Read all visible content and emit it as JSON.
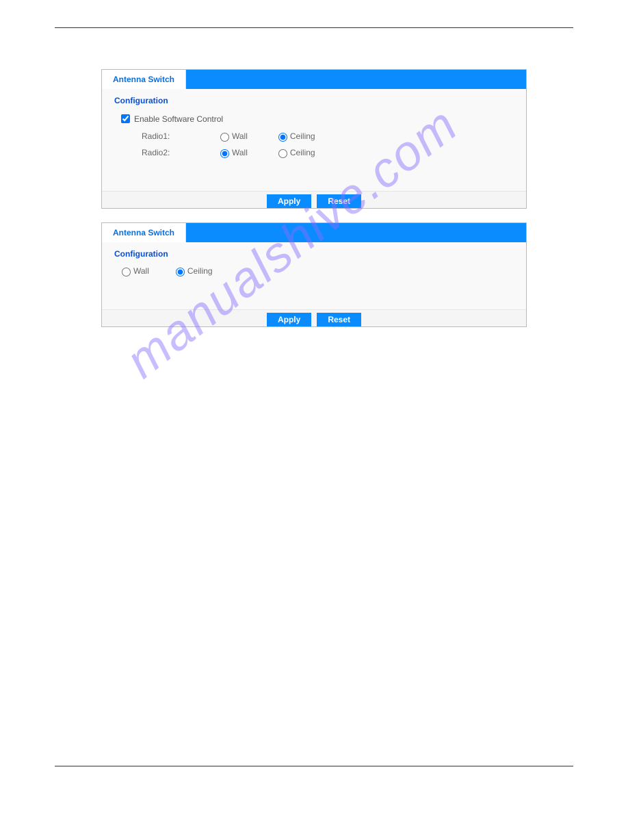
{
  "watermark": "manualshive.com",
  "panel1": {
    "tab": "Antenna Switch",
    "section": "Configuration",
    "enable_label": "Enable Software Control",
    "enable_checked": true,
    "rows": [
      {
        "label": "Radio1:",
        "wall_checked": false,
        "ceiling_checked": true,
        "wall_label": "Wall",
        "ceiling_label": "Ceiling"
      },
      {
        "label": "Radio2:",
        "wall_checked": true,
        "ceiling_checked": false,
        "wall_label": "Wall",
        "ceiling_label": "Ceiling"
      }
    ],
    "apply": "Apply",
    "reset": "Reset"
  },
  "panel2": {
    "tab": "Antenna Switch",
    "section": "Configuration",
    "wall_label": "Wall",
    "ceiling_label": "Ceiling",
    "wall_checked": false,
    "ceiling_checked": true,
    "apply": "Apply",
    "reset": "Reset"
  }
}
